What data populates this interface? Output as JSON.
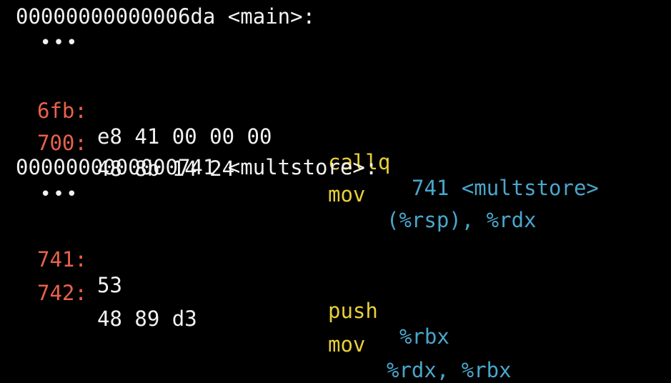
{
  "colors": {
    "background": "#000000",
    "text": "#f2f2f2",
    "address": "#e8624a",
    "mnemonic": "#e8cf3a",
    "operand": "#4aa6cc"
  },
  "blocks": [
    {
      "header": "00000000000006da <main>:",
      "ellipsis": "•••",
      "instructions": [
        {
          "addr": "6fb:",
          "bytes": "e8 41 00 00 00",
          "mnemonic": "callq",
          "operands": "741 <multstore>"
        },
        {
          "addr": "700:",
          "bytes": "48 8b 14 24",
          "mnemonic": "mov",
          "operands": "(%rsp), %rdx"
        }
      ]
    },
    {
      "header": "0000000000000741 <multstore>:",
      "ellipsis": "•••",
      "instructions": [
        {
          "addr": "741:",
          "bytes": "53",
          "mnemonic": "push",
          "operands": "%rbx"
        },
        {
          "addr": "742:",
          "bytes": "48 89 d3",
          "mnemonic": "mov",
          "operands": "%rdx, %rbx"
        }
      ]
    }
  ]
}
